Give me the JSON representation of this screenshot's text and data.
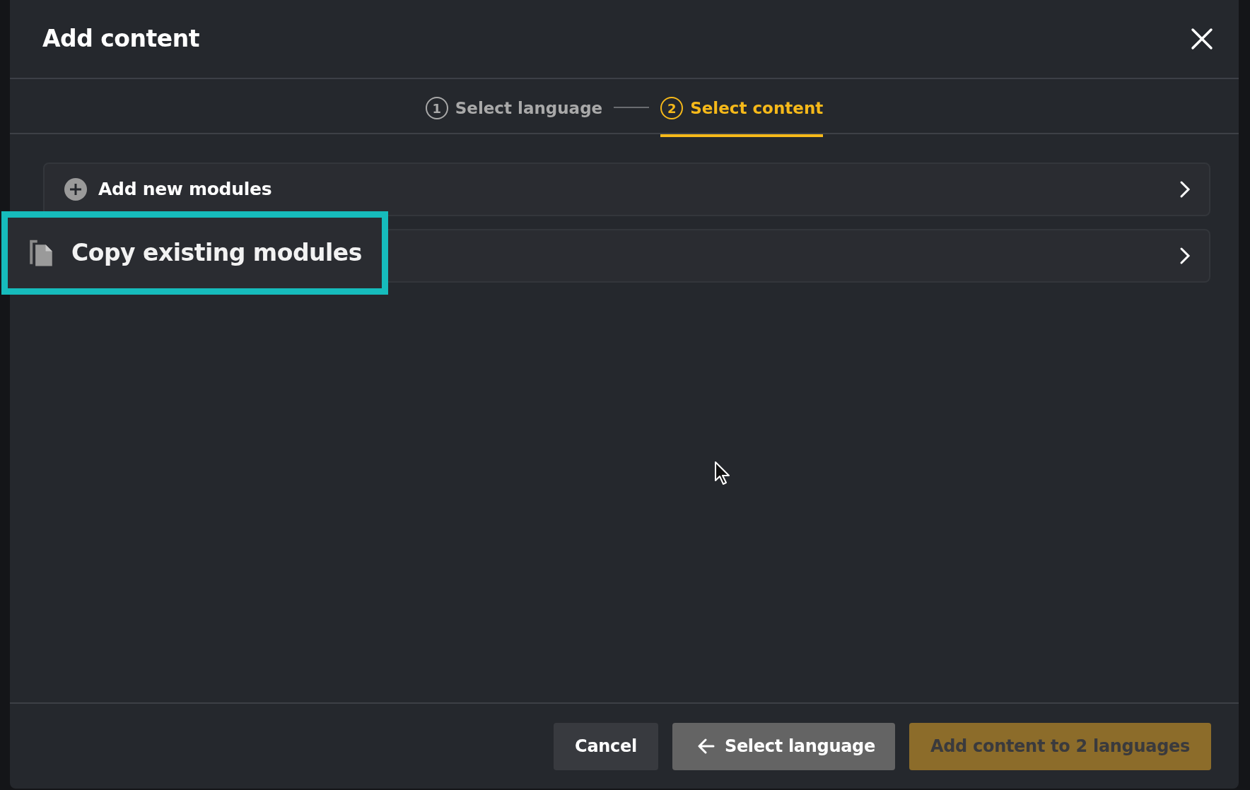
{
  "dialog": {
    "title": "Add content"
  },
  "steps": [
    {
      "number": "1",
      "label": "Select language",
      "selected": false
    },
    {
      "number": "2",
      "label": "Select content",
      "selected": true
    }
  ],
  "options": [
    {
      "kind": "add",
      "label": "Add new modules",
      "highlighted": false
    },
    {
      "kind": "copy",
      "label": "Copy existing modules",
      "highlighted": true
    }
  ],
  "buttons": [
    {
      "kind": "cancel",
      "label": "Cancel",
      "disabled": false
    },
    {
      "kind": "back",
      "label": "Select language",
      "disabled": false
    },
    {
      "kind": "primary",
      "label": "Add content to 2 languages",
      "disabled": true
    }
  ]
}
